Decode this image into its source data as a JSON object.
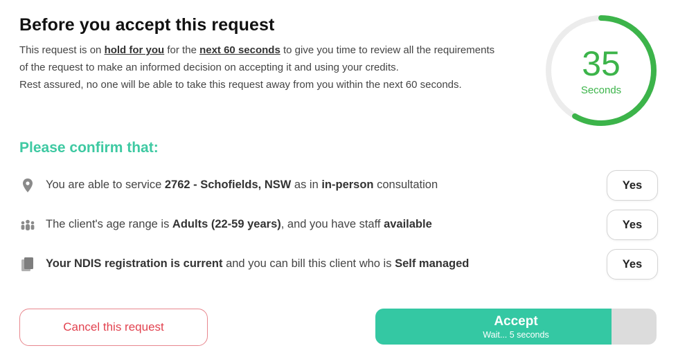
{
  "header": {
    "title": "Before you accept this request"
  },
  "intro": {
    "p1_a": "This request is on ",
    "p1_hold": "hold for you",
    "p1_b": " for the ",
    "p1_secs": "next 60 seconds",
    "p1_c": " to give you time to review all the requirements of the request to make an informed decision on accepting it and using your credits.",
    "p2": "Rest assured, no one will be able to take this request away from you within the next 60 seconds."
  },
  "timer": {
    "value": "35",
    "unit": "Seconds",
    "remaining_fraction": 0.583,
    "color": "#3cb44a",
    "track_color": "#ececec"
  },
  "confirm": {
    "heading": "Please confirm that:",
    "items": [
      {
        "icon": "location-pin-icon",
        "t1": "You are able to service ",
        "b1": "2762 - Schofields, NSW",
        "t2": " as in ",
        "b2": "in-person",
        "t3": " consultation",
        "button": "Yes"
      },
      {
        "icon": "people-group-icon",
        "t1": "The client's age range is ",
        "b1": "Adults (22-59 years)",
        "t2": ", and you have staff ",
        "b2": "available",
        "t3": "",
        "button": "Yes"
      },
      {
        "icon": "document-copy-icon",
        "t1": "",
        "b1": "Your NDIS registration is current",
        "t2": " and you can bill this client who is ",
        "b2": "Self managed",
        "t3": "",
        "button": "Yes"
      }
    ]
  },
  "actions": {
    "cancel_label": "Cancel this request",
    "accept_label": "Accept",
    "accept_sub": "Wait... 5 seconds",
    "accept_progress_fraction": 0.84,
    "accept_color": "#34c8a3",
    "cancel_color": "#e2424f"
  }
}
